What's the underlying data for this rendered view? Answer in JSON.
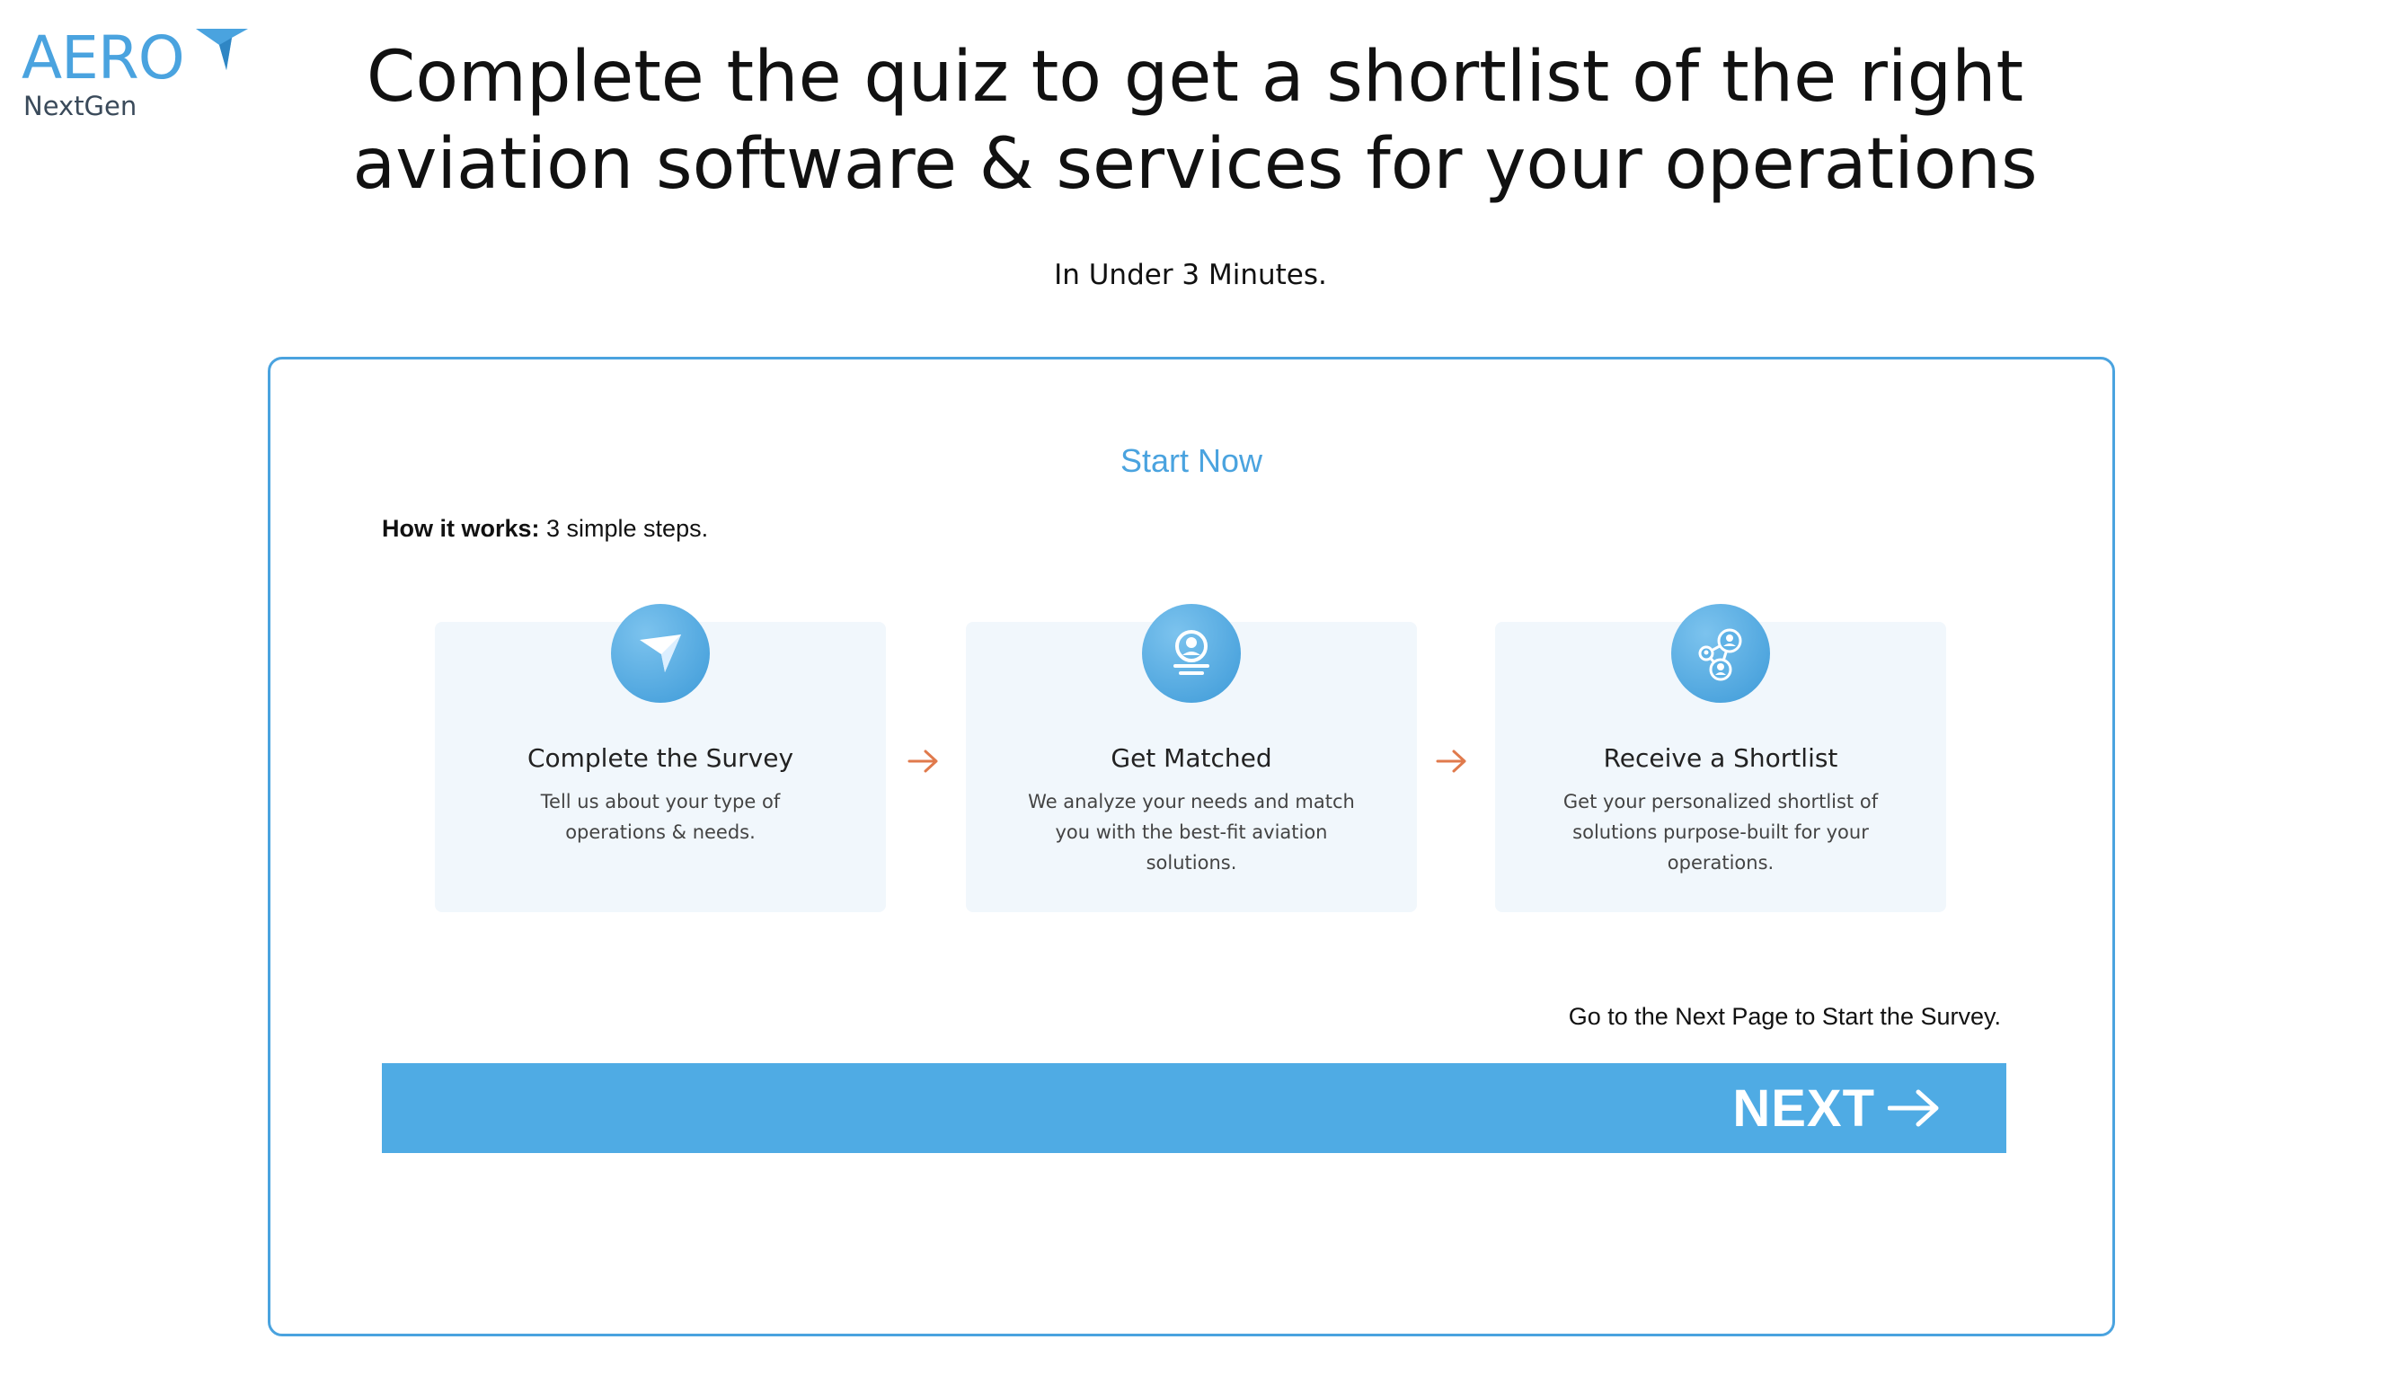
{
  "logo": {
    "word": "AERO",
    "sub": "NextGen"
  },
  "header": {
    "headline_line1": "Complete the quiz to get a shortlist of the right",
    "headline_line2": "aviation software & services for your operations",
    "subline": "In Under 3 Minutes."
  },
  "card": {
    "start_now": "Start Now",
    "how_label": "How it works:",
    "how_text": " 3 simple steps.",
    "steps": [
      {
        "icon": "paper-plane-icon",
        "title": "Complete the Survey",
        "desc": "Tell us about your type of operations & needs."
      },
      {
        "icon": "user-match-icon",
        "title": "Get Matched",
        "desc": "We analyze your needs and match you with the best-fit aviation solutions."
      },
      {
        "icon": "network-users-icon",
        "title": "Receive a Shortlist",
        "desc": "Get your personalized shortlist of solutions purpose-built for your operations."
      }
    ],
    "next_hint": "Go to the Next Page to Start the Survey.",
    "next_button": "NEXT"
  },
  "colors": {
    "accent": "#4aa3df",
    "button": "#4fabe4",
    "step_bg": "#f1f7fc",
    "arrow": "#e07a4c"
  }
}
